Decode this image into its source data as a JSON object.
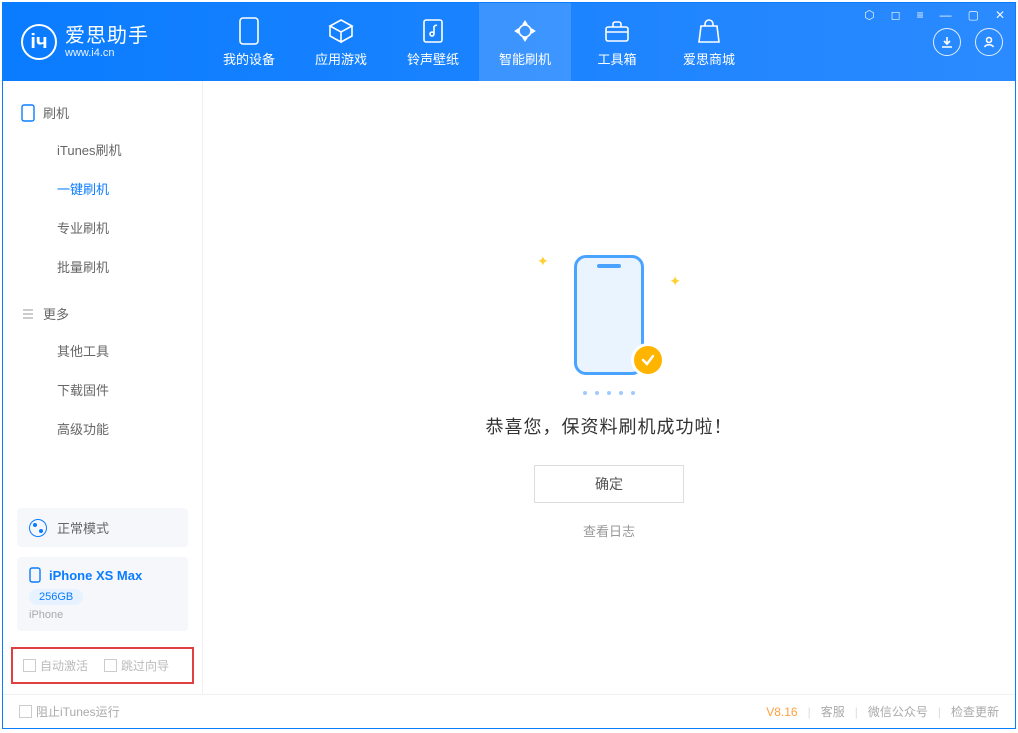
{
  "logo": {
    "title": "爱思助手",
    "url": "www.i4.cn"
  },
  "tabs": [
    {
      "label": "我的设备"
    },
    {
      "label": "应用游戏"
    },
    {
      "label": "铃声壁纸"
    },
    {
      "label": "智能刷机"
    },
    {
      "label": "工具箱"
    },
    {
      "label": "爱思商城"
    }
  ],
  "sidebar": {
    "group1": "刷机",
    "items1": [
      {
        "label": "iTunes刷机"
      },
      {
        "label": "一键刷机"
      },
      {
        "label": "专业刷机"
      },
      {
        "label": "批量刷机"
      }
    ],
    "group2": "更多",
    "items2": [
      {
        "label": "其他工具"
      },
      {
        "label": "下载固件"
      },
      {
        "label": "高级功能"
      }
    ]
  },
  "mode": "正常模式",
  "device": {
    "name": "iPhone XS Max",
    "storage": "256GB",
    "type": "iPhone"
  },
  "checks": {
    "auto_activate": "自动激活",
    "skip_guide": "跳过向导"
  },
  "main": {
    "message": "恭喜您，保资料刷机成功啦！",
    "ok": "确定",
    "view_log": "查看日志"
  },
  "footer": {
    "block_itunes": "阻止iTunes运行",
    "version": "V8.16",
    "support": "客服",
    "wechat": "微信公众号",
    "update": "检查更新"
  }
}
